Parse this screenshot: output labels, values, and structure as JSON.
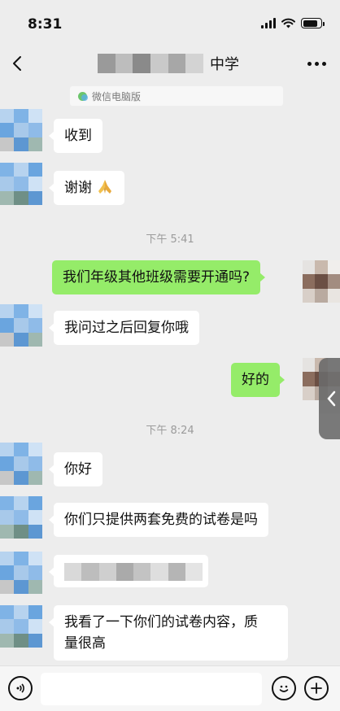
{
  "status_bar": {
    "time": "8:31",
    "battery_level": 0.85
  },
  "nav": {
    "title_suffix": "中学",
    "back_icon": "chevron-left-icon",
    "more_icon": "more-dots-icon"
  },
  "chip": {
    "label": "微信电脑版"
  },
  "messages": [
    {
      "side": "left",
      "text": "收到"
    },
    {
      "side": "left",
      "text": "谢谢",
      "emoji": "folded-hands"
    },
    {
      "type": "time",
      "text": "下午 5:41"
    },
    {
      "side": "right",
      "text": "我们年级其他班级需要开通吗?"
    },
    {
      "side": "left",
      "text": "我问过之后回复你哦"
    },
    {
      "side": "right",
      "text": "好的"
    },
    {
      "type": "time",
      "text": "下午 8:24"
    },
    {
      "side": "left",
      "text": "你好"
    },
    {
      "side": "left",
      "text": "你们只提供两套免费的试卷是吗"
    },
    {
      "side": "left",
      "text": ""
    },
    {
      "side": "left",
      "text_line1": "我看了一下你们的试卷内容，质",
      "text_line2": "量很高"
    }
  ],
  "input_bar": {
    "placeholder": "",
    "voice_icon": "voice-icon",
    "emoji_icon": "emoji-icon",
    "plus_icon": "plus-icon"
  },
  "colors": {
    "bubble_green": "#95ec69",
    "bubble_white": "#ffffff",
    "background": "#ededed"
  }
}
